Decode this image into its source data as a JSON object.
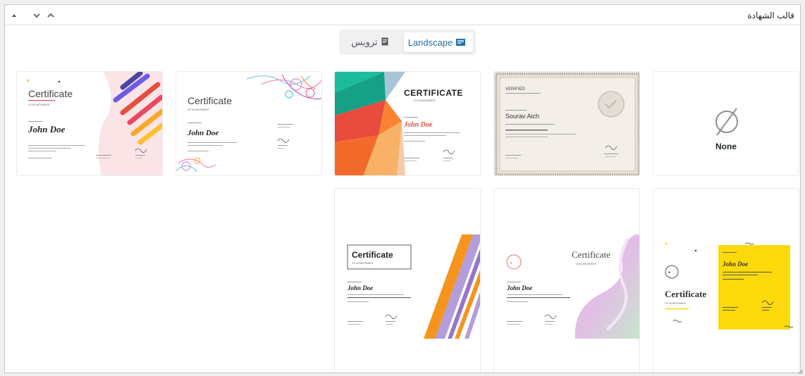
{
  "panel": {
    "title": "قالب الشهادة"
  },
  "orientation": {
    "portrait_label": "ترويس",
    "landscape_label": "Landscape",
    "selected": "Landscape"
  },
  "templates": {
    "none_label": "None",
    "cert_1": {
      "title": "Certificate",
      "subtitle": "OF ACHIEVEMENT",
      "name": "John Doe"
    },
    "cert_2": {
      "title": "Certificate",
      "subtitle": "OF ACHIEVEMENT",
      "name": "John Doe"
    },
    "cert_3": {
      "title": "CERTIFICATE",
      "subtitle": "OF ACHIEVEMENT",
      "name": "John Doe"
    },
    "cert_4": {
      "title": "VERIFIED",
      "name": "Sourav Aich"
    },
    "cert_5": {
      "title": "Certificate",
      "subtitle": "OF ACHIEVEMENT",
      "name": "John Doe"
    },
    "cert_6": {
      "title": "Certificate",
      "subtitle": "of ACHIEVEMENT",
      "name": "John Doe"
    },
    "cert_7": {
      "title": "Certificate",
      "subtitle": "OF ACHIEVEMENT",
      "name": "John Doe"
    }
  },
  "colors": {
    "accent": "#2271b1",
    "border": "#c3c4c7"
  }
}
